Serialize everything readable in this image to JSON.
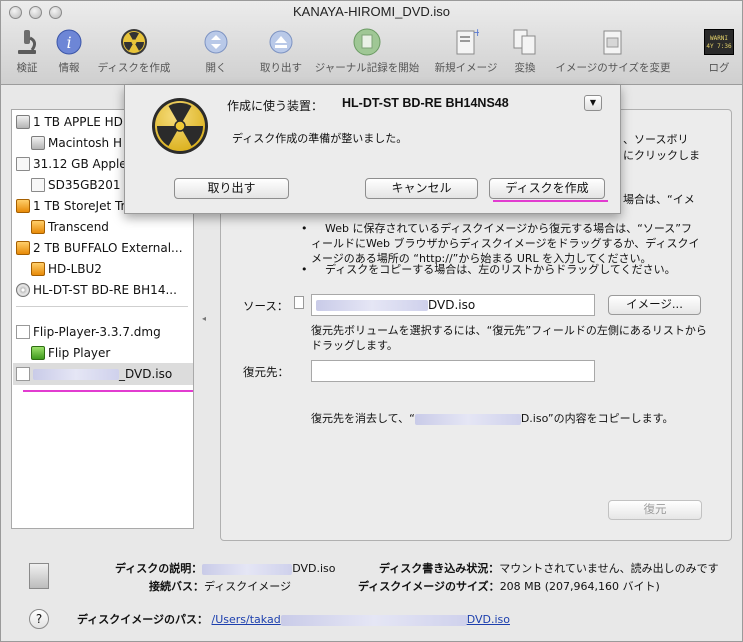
{
  "window": {
    "title": "KANAYA-HIROMI_DVD.iso"
  },
  "toolbar": {
    "items": [
      {
        "label": "検証"
      },
      {
        "label": "情報"
      },
      {
        "label": "ディスクを作成"
      },
      {
        "label": "開く"
      },
      {
        "label": "取り出す"
      },
      {
        "label": "ジャーナル記録を開始"
      },
      {
        "label": "新規イメージ"
      },
      {
        "label": "変換"
      },
      {
        "label": "イメージのサイズを変更"
      },
      {
        "label": "ログ"
      }
    ],
    "log_badge": "WARNI\n4Y 7:36"
  },
  "sidebar": {
    "items": [
      {
        "label": "1 TB APPLE HD"
      },
      {
        "label": "Macintosh H"
      },
      {
        "label": "31.12 GB Apple"
      },
      {
        "label": "SD35GB201"
      },
      {
        "label": "1 TB StoreJet Tr"
      },
      {
        "label": "Transcend"
      },
      {
        "label": "2 TB BUFFALO External..."
      },
      {
        "label": "HD-LBU2"
      },
      {
        "label": "HL-DT-ST BD-RE BH14..."
      },
      {
        "label": "Flip-Player-3.3.7.dmg"
      },
      {
        "label": "Flip Player"
      },
      {
        "label": "_DVD.iso"
      }
    ]
  },
  "panel": {
    "instructions_top": [
      "、ソースボリ",
      "にクリックしま"
    ],
    "instructions_mid": "場合は、“イメ",
    "bullet1": "Web に保存されているディスクイメージから復元する場合は、“ソース”フィールドにWeb ブラウザからディスクイメージをドラッグするか、ディスクイメージのある場所の “http://”から始まる URL を入力してください。",
    "bullet2": "ディスクをコピーする場合は、左のリストからドラッグしてください。",
    "source_label": "ソース：",
    "source_value": "DVD.iso",
    "image_button": "イメージ...",
    "source_hint": "復元先ボリュームを選択するには、“復元先”フィールドの左側にあるリストからドラッグします。",
    "dest_label": "復元先：",
    "dest_value": "",
    "copy_note_prefix": "復元先を消去して、“",
    "copy_note_suffix": "D.iso”の内容をコピーします。",
    "restore_button": "復元"
  },
  "info": {
    "desc_label": "ディスクの説明：",
    "desc_value": "DVD.iso",
    "conn_label": "接続バス：",
    "conn_value": "ディスクイメージ",
    "write_label": "ディスク書き込み状況：",
    "write_value": "マウントされていません、読み出しのみです",
    "size_label": "ディスクイメージのサイズ：",
    "size_value": "208 MB (207,964,160 バイト)",
    "path_label": "ディスクイメージのパス：",
    "path_value_start": "/Users/takad",
    "path_value_end": "DVD.iso",
    "help": "?"
  },
  "sheet": {
    "device_label": "作成に使う装置：",
    "device_value": "HL-DT-ST BD-RE BH14NS48",
    "status": "ディスク作成の準備が整いました。",
    "eject_button": "取り出す",
    "cancel_button": "キャンセル",
    "burn_button": "ディスクを作成"
  },
  "colors": {
    "accent_underline": "#e23cd0",
    "link": "#1c3fae"
  }
}
